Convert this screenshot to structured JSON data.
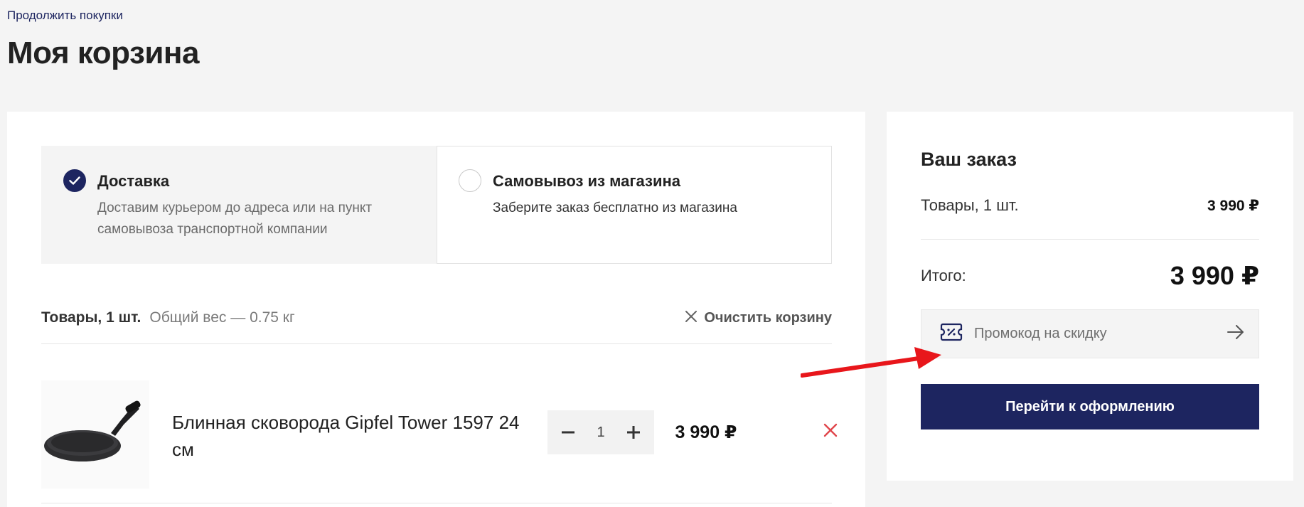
{
  "nav": {
    "continue_label": "Продолжить покупки"
  },
  "page": {
    "title": "Моя корзина"
  },
  "delivery": {
    "options": [
      {
        "title": "Доставка",
        "description": "Доставим курьером до адреса или на пункт самовывоза транспортной компании",
        "selected": true
      },
      {
        "title": "Самовывоз из магазина",
        "description": "Заберите заказ бесплатно из магазина",
        "selected": false
      }
    ]
  },
  "items_header": {
    "count_label": "Товары, 1 шт.",
    "weight_label": "Общий вес — 0.75 кг",
    "clear_label": "Очистить корзину"
  },
  "cart": {
    "items": [
      {
        "name": "Блинная сковорода Gipfel Tower 1597 24 см",
        "quantity": "1",
        "price": "3 990 ₽"
      }
    ]
  },
  "order": {
    "title": "Ваш заказ",
    "items_label": "Товары, 1 шт.",
    "items_value": "3 990 ₽",
    "total_label": "Итого:",
    "total_value": "3 990 ₽",
    "promo_placeholder": "Промокод на скидку",
    "checkout_label": "Перейти к оформлению"
  },
  "colors": {
    "brand": "#1d2560",
    "background": "#f4f4f4",
    "remove": "#e0454b",
    "annotation": "#e8161b"
  },
  "icons": [
    "check-icon",
    "close-icon",
    "minus-icon",
    "plus-icon",
    "remove-icon",
    "coupon-icon",
    "arrow-right-icon"
  ]
}
